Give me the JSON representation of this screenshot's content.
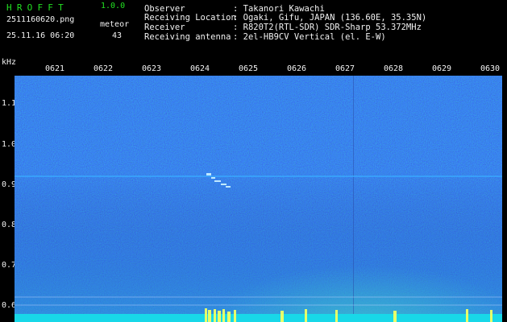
{
  "header": {
    "app_title": "HROFFT",
    "version": "1.0.0",
    "filename": "2511160620.png",
    "datetime": "25.11.16 06:20",
    "meteor_label": "meteor",
    "meteor_count": "43"
  },
  "station": [
    {
      "label": "Observer",
      "value": ": Takanori Kawachi"
    },
    {
      "label": "Receiving Location",
      "value": ": Ogaki, Gifu, JAPAN (136.60E, 35.35N)"
    },
    {
      "label": "Receiver",
      "value": ": R820T2(RTL-SDR) SDR-Sharp 53.372MHz"
    },
    {
      "label": "Receiving antenna",
      "value": ": 2el-HB9CV Vertical (el. E-W)"
    }
  ],
  "axis": {
    "y_unit": "kHz",
    "x_ticks": [
      "0621",
      "0622",
      "0623",
      "0624",
      "0625",
      "0626",
      "0627",
      "0628",
      "0629",
      "0630"
    ],
    "y_ticks": [
      "1.1",
      "1.0",
      "0.9",
      "0.8",
      "0.7",
      "0.6"
    ]
  },
  "colors": {
    "background": "#000000",
    "waterfall_base": "#0a1a6e",
    "carrier_line": "#39a8ff",
    "meteor_echo": "#e6ff6a",
    "text_green": "#22e022",
    "text_white": "#f2f2f2"
  }
}
